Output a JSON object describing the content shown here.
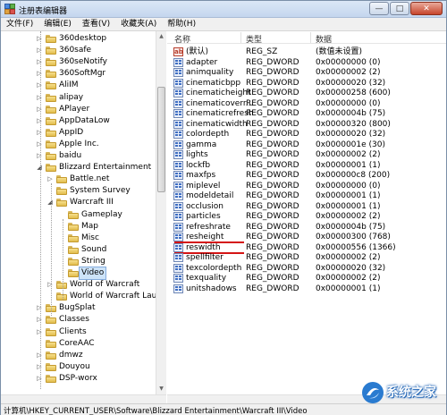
{
  "window": {
    "title": "注册表编辑器",
    "buttons": {
      "minimize": "—",
      "maximize": "□",
      "close": "✕"
    }
  },
  "menu": [
    "文件(F)",
    "编辑(E)",
    "查看(V)",
    "收藏夹(A)",
    "帮助(H)"
  ],
  "tree": {
    "items": [
      {
        "label": "360desktop",
        "level": 1,
        "arrow": "▷"
      },
      {
        "label": "360safe",
        "level": 1,
        "arrow": "▷"
      },
      {
        "label": "360seNotify",
        "level": 1,
        "arrow": "▷"
      },
      {
        "label": "360SoftMgr",
        "level": 1,
        "arrow": "▷"
      },
      {
        "label": "AliIM",
        "level": 1,
        "arrow": "▷"
      },
      {
        "label": "alipay",
        "level": 1,
        "arrow": "▷"
      },
      {
        "label": "APlayer",
        "level": 1,
        "arrow": "▷"
      },
      {
        "label": "AppDataLow",
        "level": 1,
        "arrow": "▷"
      },
      {
        "label": "AppID",
        "level": 1,
        "arrow": "▷"
      },
      {
        "label": "Apple Inc.",
        "level": 1,
        "arrow": "▷"
      },
      {
        "label": "baidu",
        "level": 1,
        "arrow": "▷"
      },
      {
        "label": "Blizzard Entertainment",
        "level": 1,
        "arrow": "◢"
      },
      {
        "label": "Battle.net",
        "level": 2,
        "arrow": "▷"
      },
      {
        "label": "System Survey",
        "level": 2,
        "arrow": ""
      },
      {
        "label": "Warcraft III",
        "level": 2,
        "arrow": "◢"
      },
      {
        "label": "Gameplay",
        "level": 3,
        "arrow": ""
      },
      {
        "label": "Map",
        "level": 3,
        "arrow": ""
      },
      {
        "label": "Misc",
        "level": 3,
        "arrow": ""
      },
      {
        "label": "Sound",
        "level": 3,
        "arrow": ""
      },
      {
        "label": "String",
        "level": 3,
        "arrow": ""
      },
      {
        "label": "Video",
        "level": 3,
        "arrow": "",
        "selected": true
      },
      {
        "label": "World of Warcraft",
        "level": 2,
        "arrow": "▷"
      },
      {
        "label": "World of Warcraft Laur",
        "level": 2,
        "arrow": ""
      },
      {
        "label": "BugSplat",
        "level": 1,
        "arrow": "▷"
      },
      {
        "label": "Classes",
        "level": 1,
        "arrow": "▷"
      },
      {
        "label": "Clients",
        "level": 1,
        "arrow": "▷"
      },
      {
        "label": "CoreAAC",
        "level": 1,
        "arrow": ""
      },
      {
        "label": "dmwz",
        "level": 1,
        "arrow": "▷"
      },
      {
        "label": "Douyou",
        "level": 1,
        "arrow": "▷"
      },
      {
        "label": "DSP-worx",
        "level": 1,
        "arrow": "▷"
      }
    ]
  },
  "list": {
    "headers": {
      "name": "名称",
      "type": "类型",
      "data": "数据"
    },
    "rows": [
      {
        "name": "(默认)",
        "type": "REG_SZ",
        "data": "(数值未设置)",
        "kind": "sz"
      },
      {
        "name": "adapter",
        "type": "REG_DWORD",
        "data": "0x00000000 (0)",
        "kind": "dword"
      },
      {
        "name": "animquality",
        "type": "REG_DWORD",
        "data": "0x00000002 (2)",
        "kind": "dword"
      },
      {
        "name": "cinematicbpp",
        "type": "REG_DWORD",
        "data": "0x00000020 (32)",
        "kind": "dword"
      },
      {
        "name": "cinematicheight",
        "type": "REG_DWORD",
        "data": "0x00000258 (600)",
        "kind": "dword"
      },
      {
        "name": "cinematicoverr...",
        "type": "REG_DWORD",
        "data": "0x00000000 (0)",
        "kind": "dword"
      },
      {
        "name": "cinematicrefresh",
        "type": "REG_DWORD",
        "data": "0x0000004b (75)",
        "kind": "dword"
      },
      {
        "name": "cinematicwidth",
        "type": "REG_DWORD",
        "data": "0x00000320 (800)",
        "kind": "dword"
      },
      {
        "name": "colordepth",
        "type": "REG_DWORD",
        "data": "0x00000020 (32)",
        "kind": "dword"
      },
      {
        "name": "gamma",
        "type": "REG_DWORD",
        "data": "0x0000001e (30)",
        "kind": "dword"
      },
      {
        "name": "lights",
        "type": "REG_DWORD",
        "data": "0x00000002 (2)",
        "kind": "dword"
      },
      {
        "name": "lockfb",
        "type": "REG_DWORD",
        "data": "0x00000001 (1)",
        "kind": "dword"
      },
      {
        "name": "maxfps",
        "type": "REG_DWORD",
        "data": "0x000000c8 (200)",
        "kind": "dword"
      },
      {
        "name": "miplevel",
        "type": "REG_DWORD",
        "data": "0x00000000 (0)",
        "kind": "dword"
      },
      {
        "name": "modeldetail",
        "type": "REG_DWORD",
        "data": "0x00000001 (1)",
        "kind": "dword"
      },
      {
        "name": "occlusion",
        "type": "REG_DWORD",
        "data": "0x00000001 (1)",
        "kind": "dword"
      },
      {
        "name": "particles",
        "type": "REG_DWORD",
        "data": "0x00000002 (2)",
        "kind": "dword"
      },
      {
        "name": "refreshrate",
        "type": "REG_DWORD",
        "data": "0x0000004b (75)",
        "kind": "dword"
      },
      {
        "name": "resheight",
        "type": "REG_DWORD",
        "data": "0x00000300 (768)",
        "kind": "dword",
        "highlight": true
      },
      {
        "name": "reswidth",
        "type": "REG_DWORD",
        "data": "0x00000556 (1366)",
        "kind": "dword",
        "highlight": true
      },
      {
        "name": "spellfilter",
        "type": "REG_DWORD",
        "data": "0x00000002 (2)",
        "kind": "dword"
      },
      {
        "name": "texcolordepth",
        "type": "REG_DWORD",
        "data": "0x00000020 (32)",
        "kind": "dword"
      },
      {
        "name": "texquality",
        "type": "REG_DWORD",
        "data": "0x00000002 (2)",
        "kind": "dword"
      },
      {
        "name": "unitshadows",
        "type": "REG_DWORD",
        "data": "0x00000001 (1)",
        "kind": "dword"
      }
    ]
  },
  "status": "计算机\\HKEY_CURRENT_USER\\Software\\Blizzard Entertainment\\Warcraft III\\Video",
  "watermark": {
    "text": "系统之家"
  },
  "colors": {
    "highlight_underline": "#d41414",
    "selection": "#cde3f8"
  }
}
